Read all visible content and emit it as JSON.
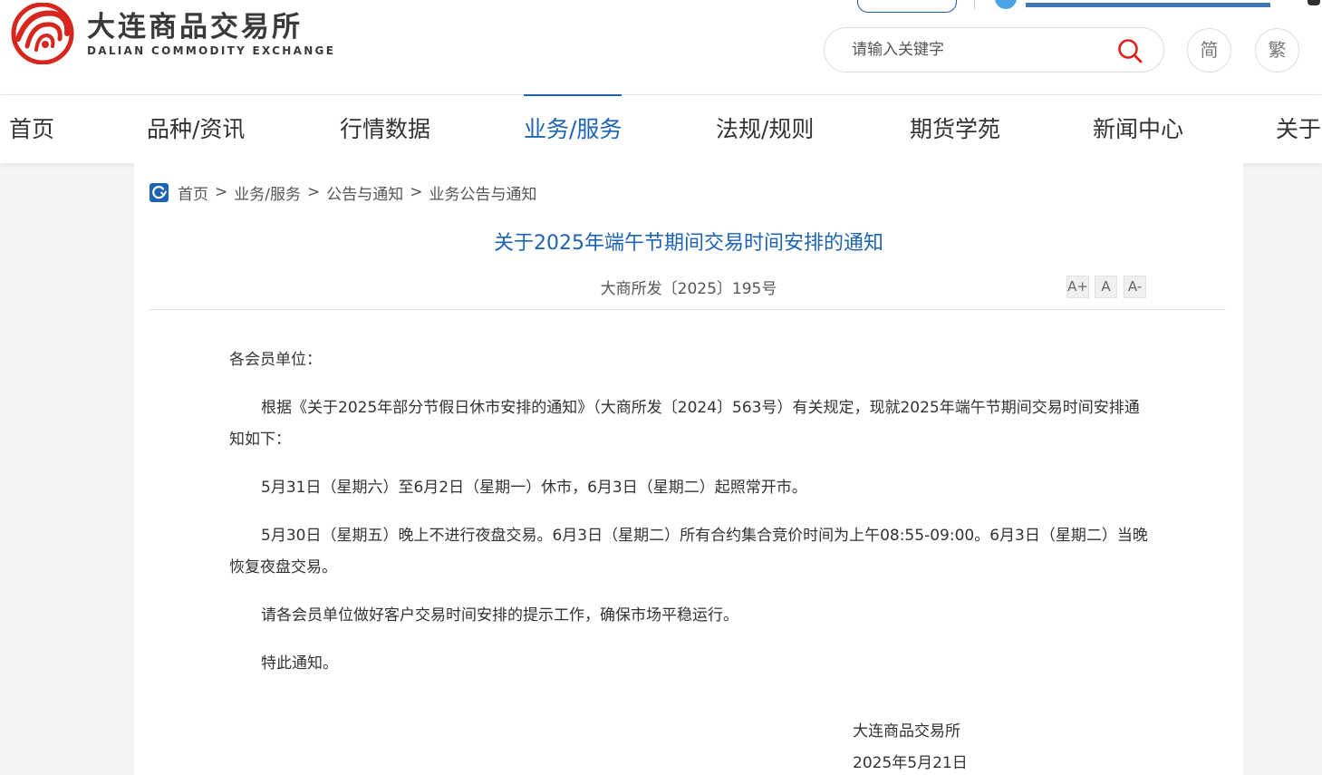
{
  "colors": {
    "brand_blue": "#1e64b4",
    "logo_red": "#d7261d"
  },
  "header": {
    "logo_cn": "大连商品交易所",
    "logo_en": "DALIAN COMMODITY EXCHANGE",
    "search_placeholder": "请输入关键字",
    "lang_simplified": "简",
    "lang_traditional": "繁"
  },
  "nav": [
    {
      "label": "首页"
    },
    {
      "label": "品种/资讯"
    },
    {
      "label": "行情数据"
    },
    {
      "label": "业务/服务"
    },
    {
      "label": "法规/规则"
    },
    {
      "label": "期货学苑"
    },
    {
      "label": "新闻中心"
    },
    {
      "label": "关于"
    }
  ],
  "breadcrumb": [
    "首页",
    "业务/服务",
    "公告与通知",
    "业务公告与通知"
  ],
  "article": {
    "title": "关于2025年端午节期间交易时间安排的通知",
    "doc_no": "大商所发〔2025〕195号",
    "font_controls": [
      "A+",
      "A",
      "A-"
    ],
    "salutation": "各会员单位：",
    "paragraphs": [
      "根据《关于2025年部分节假日休市安排的通知》（大商所发〔2024〕563号）有关规定，现就2025年端午节期间交易时间安排通知如下：",
      "5月31日（星期六）至6月2日（星期一）休市，6月3日（星期二）起照常开市。",
      "5月30日（星期五）晚上不进行夜盘交易。6月3日（星期二）所有合约集合竞价时间为上午08:55-09:00。6月3日（星期二）当晚恢复夜盘交易。",
      "请各会员单位做好客户交易时间安排的提示工作，确保市场平稳运行。",
      "特此通知。"
    ],
    "signature": "大连商品交易所",
    "date": "2025年5月21日"
  }
}
